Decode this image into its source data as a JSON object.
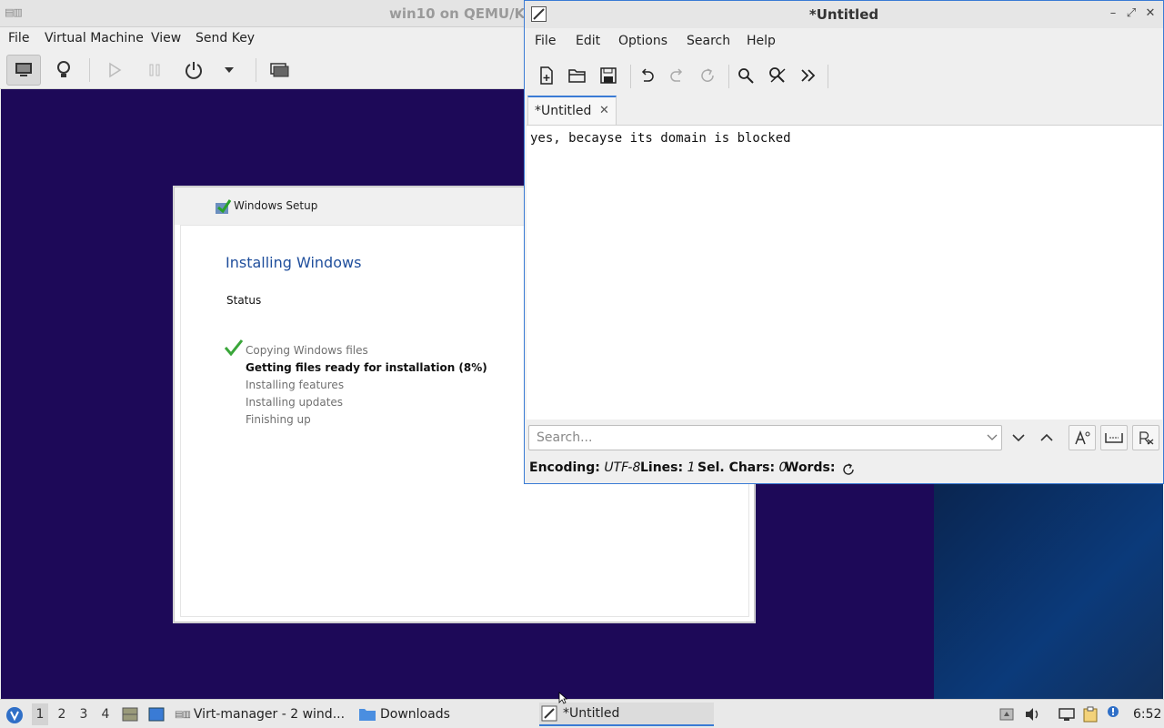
{
  "vm": {
    "title": "win10 on QEMU/KVM",
    "menu": [
      "File",
      "Virtual Machine",
      "View",
      "Send Key"
    ]
  },
  "setup": {
    "window_title": "Windows Setup",
    "heading": "Installing Windows",
    "status_label": "Status",
    "steps": [
      "Copying Windows files",
      "Getting files ready for installation (8%)",
      "Installing features",
      "Installing updates",
      "Finishing up"
    ],
    "progress_percent": 8
  },
  "editor": {
    "title": "*Untitled",
    "menu": [
      "File",
      "Edit",
      "Options",
      "Search",
      "Help"
    ],
    "tab_label": "*Untitled",
    "content": "yes, becayse its domain is blocked",
    "search_placeholder": "Search...",
    "status": {
      "encoding_label": "Encoding:",
      "encoding_value": "UTF-8",
      "lines_label": "Lines:",
      "lines_value": "1",
      "selchars_label": "Sel. Chars:",
      "selchars_value": "0",
      "words_label": "Words:"
    }
  },
  "taskbar": {
    "workspaces": [
      "1",
      "2",
      "3",
      "4"
    ],
    "tasks": [
      "Virt-manager - 2 wind...",
      "Downloads",
      "*Untitled"
    ],
    "clock": "6:52"
  },
  "colors": {
    "accent": "#3a7bd5",
    "guest_background": "#1d0958",
    "setup_heading": "#1f4e9c"
  }
}
